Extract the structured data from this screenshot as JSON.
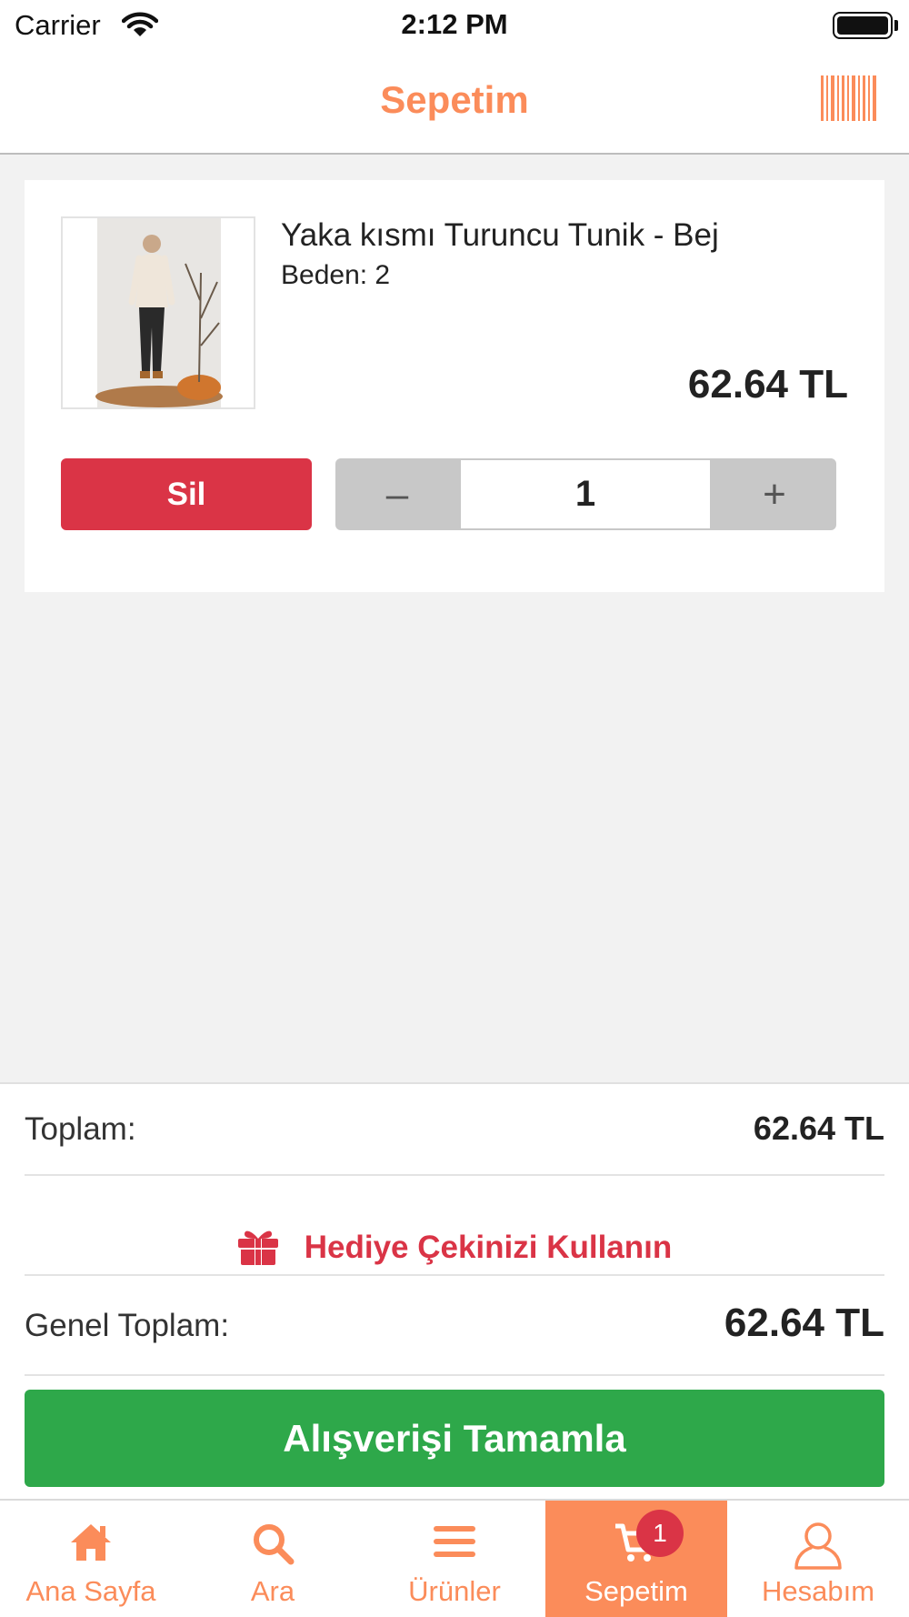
{
  "status_bar": {
    "carrier": "Carrier",
    "time": "2:12 PM"
  },
  "nav": {
    "title": "Sepetim",
    "barcode_icon": "barcode-icon"
  },
  "cart": {
    "items": [
      {
        "name": "Yaka kısmı Turuncu Tunik - Bej",
        "size_label": "Beden: 2",
        "price": "62.64 TL",
        "delete_label": "Sil",
        "minus_label": "–",
        "quantity": "1",
        "plus_label": "+"
      }
    ]
  },
  "summary": {
    "subtotal_label": "Toplam:",
    "subtotal_value": "62.64 TL",
    "gift_label": "Hediye Çekinizi Kullanın",
    "gift_icon": "gift-icon",
    "total_label": "Genel Toplam:",
    "total_value": "62.64 TL",
    "checkout_label": "Alışverişi Tamamla"
  },
  "tab_bar": {
    "tabs": [
      {
        "label": "Ana Sayfa",
        "icon": "home-icon"
      },
      {
        "label": "Ara",
        "icon": "search-icon"
      },
      {
        "label": "Ürünler",
        "icon": "menu-icon"
      },
      {
        "label": "Sepetim",
        "icon": "cart-icon",
        "active": true,
        "badge": "1"
      },
      {
        "label": "Hesabım",
        "icon": "user-icon"
      }
    ]
  },
  "colors": {
    "accent": "#fb8c5a",
    "danger": "#da3446",
    "success": "#2ea84a",
    "stepper": "#c8c8c8"
  }
}
